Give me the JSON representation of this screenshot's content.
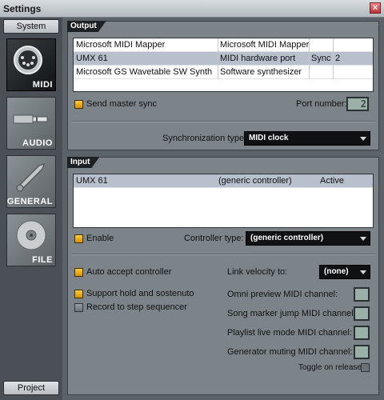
{
  "window": {
    "title": "Settings",
    "close_glyph": "×"
  },
  "sidebar": {
    "tabs": {
      "top": "System",
      "bottom": "Project"
    },
    "categories": [
      {
        "label": "MIDI",
        "icon": "midi-connector-icon",
        "active": true
      },
      {
        "label": "AUDIO",
        "icon": "audio-jack-icon",
        "active": false
      },
      {
        "label": "GENERAL",
        "icon": "wrench-icon",
        "active": false
      },
      {
        "label": "FILE",
        "icon": "disc-icon",
        "active": false
      }
    ]
  },
  "output": {
    "header": "Output",
    "rows": [
      {
        "device": "Microsoft MIDI Mapper",
        "type": "Microsoft MIDI Mapper",
        "sync": "",
        "port": ""
      },
      {
        "device": "UMX 61",
        "type": "MIDI hardware port",
        "sync": "Sync",
        "port": "2",
        "selected": true
      },
      {
        "device": "Microsoft GS Wavetable SW Synth",
        "type": "Software synthesizer",
        "sync": "",
        "port": ""
      }
    ],
    "send_master_sync_label": "Send master sync",
    "port_number_label": "Port number:",
    "port_number_value": "2",
    "sync_type_label": "Synchronization type:",
    "sync_type_value": "MIDI clock"
  },
  "input": {
    "header": "Input",
    "rows": [
      {
        "device": "UMX 61",
        "controller": "(generic controller)",
        "status": "Active",
        "selected": true
      }
    ],
    "enable_label": "Enable",
    "controller_type_label": "Controller type:",
    "controller_type_value": "(generic controller)",
    "auto_accept_label": "Auto accept controller",
    "support_hold_label": "Support hold and sostenuto",
    "record_step_label": "Record to step sequencer",
    "link_velocity_label": "Link velocity to:",
    "link_velocity_value": "(none)",
    "omni_label": "Omni preview MIDI channel:",
    "song_marker_label": "Song marker jump MIDI channel:",
    "playlist_label": "Playlist live mode MIDI channel:",
    "generator_label": "Generator muting MIDI channel:",
    "toggle_release_label": "Toggle on release"
  }
}
